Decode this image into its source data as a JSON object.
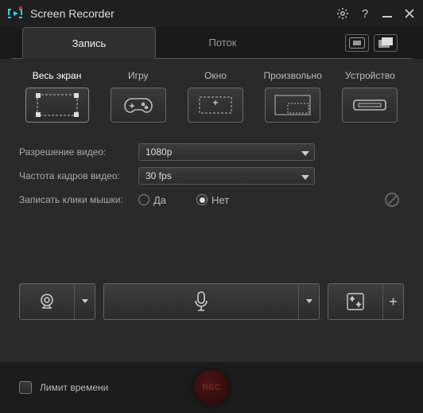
{
  "app": {
    "title": "Screen Recorder"
  },
  "tabs": {
    "record": "Запись",
    "stream": "Поток"
  },
  "modes": {
    "fullscreen": "Весь экран",
    "game": "Игру",
    "window": "Окно",
    "custom": "Произвольно",
    "device": "Устройство"
  },
  "settings": {
    "resolution_label": "Разрешение видео:",
    "resolution_value": "1080p",
    "framerate_label": "Частота кадров видео:",
    "framerate_value": "30 fps",
    "clicks_label": "Записать клики мышки:",
    "yes": "Да",
    "no": "Нет"
  },
  "footer": {
    "time_limit": "Лимит времени",
    "rec": "REC"
  },
  "fx_plus": "+"
}
